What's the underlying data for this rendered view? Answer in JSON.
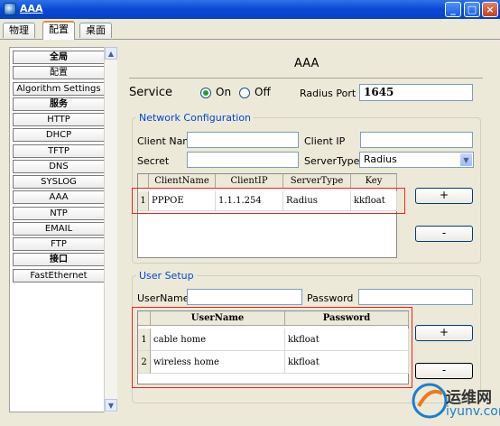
{
  "window": {
    "title": "AAA"
  },
  "tabs": [
    "物理",
    "配置",
    "桌面"
  ],
  "active_tab": 1,
  "sidebar": {
    "items": [
      {
        "label": "全局",
        "category": true
      },
      {
        "label": "配置",
        "category": false
      },
      {
        "label": "Algorithm Settings",
        "category": false
      },
      {
        "label": "服务",
        "category": true
      },
      {
        "label": "HTTP",
        "category": false
      },
      {
        "label": "DHCP",
        "category": false
      },
      {
        "label": "TFTP",
        "category": false
      },
      {
        "label": "DNS",
        "category": false
      },
      {
        "label": "SYSLOG",
        "category": false
      },
      {
        "label": "AAA",
        "category": false
      },
      {
        "label": "NTP",
        "category": false
      },
      {
        "label": "EMAIL",
        "category": false
      },
      {
        "label": "FTP",
        "category": false
      },
      {
        "label": "接口",
        "category": true
      },
      {
        "label": "FastEthernet",
        "category": false
      }
    ]
  },
  "main": {
    "heading": "AAA",
    "service_label": "Service",
    "on_label": "On",
    "off_label": "Off",
    "service_on": true,
    "radius_port_label": "Radius Port",
    "radius_port_value": "1645",
    "network": {
      "title": "Network Configuration",
      "client_name_label": "Client Name",
      "client_ip_label": "Client IP",
      "secret_label": "Secret",
      "server_type_label": "ServerType",
      "server_type_value": "Radius",
      "columns": [
        "ClientName",
        "ClientIP",
        "ServerType",
        "Key"
      ],
      "rows": [
        {
          "num": "1",
          "client_name": "PPPOE",
          "client_ip": "1.1.1.254",
          "server_type": "Radius",
          "key": "kkfloat"
        }
      ],
      "add_label": "+",
      "remove_label": "-"
    },
    "users": {
      "title": "User Setup",
      "username_label": "UserName",
      "password_label": "Password",
      "columns": [
        "UserName",
        "Password"
      ],
      "rows": [
        {
          "num": "1",
          "username": "cable home",
          "password": "kkfloat"
        },
        {
          "num": "2",
          "username": "wireless home",
          "password": "kkfloat"
        }
      ],
      "add_label": "+",
      "remove_label": "-"
    }
  },
  "watermark": {
    "cn": "运维网",
    "url": "iyunv.com"
  },
  "colors": {
    "titlebar": "#0a48d4",
    "group_title": "#0046d5",
    "highlight_border": "#e22222"
  }
}
